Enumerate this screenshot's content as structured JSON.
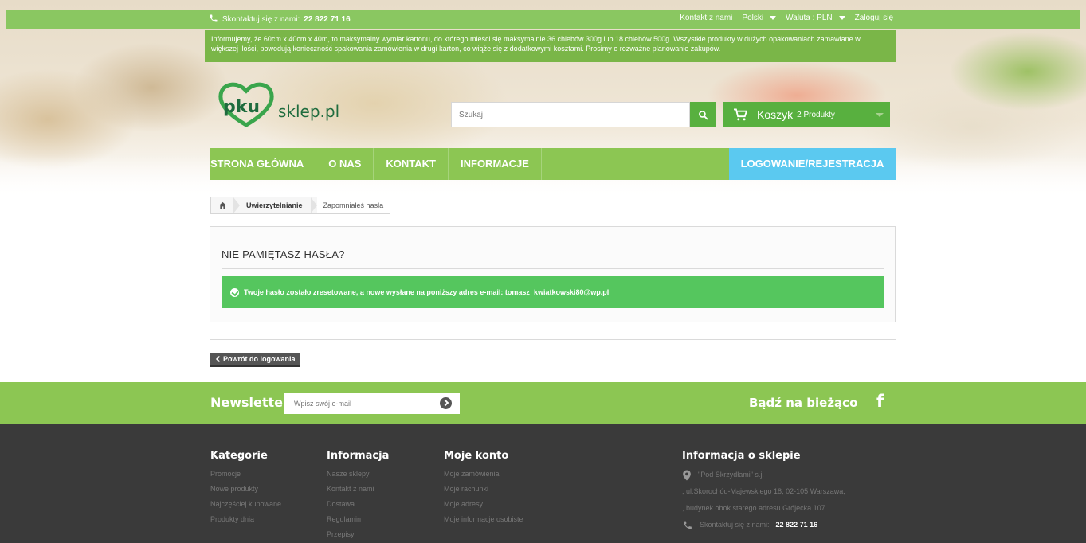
{
  "topbar": {
    "phone_label": "Skontaktuj się z nami:",
    "phone_number": "22 822 71 16",
    "contact": "Kontakt z nami",
    "language": "Polski",
    "currency": "Waluta : PLN",
    "login": "Zaloguj się"
  },
  "notice": "Informujemy, że 60cm x 40cm x 40m, to maksymalny wymiar kartonu, do którego mieści się maksymalnie 36 chlebów 300g lub 18 chlebów 500g. Wszystkie produkty w dużych opakowaniach zamawiane w większej ilości, powodują konieczność spakowania zamówienia w drugi karton, co wiąże się z dodatkowymi kosztami. Prosimy o rozważne planowanie zakupów.",
  "logo": {
    "mark": "pku",
    "text": "sklep.pl"
  },
  "search": {
    "placeholder": "Szukaj"
  },
  "cart": {
    "label": "Koszyk",
    "count": "2 Produkty"
  },
  "nav": {
    "items": [
      "STRONA GŁÓWNA",
      "O NAS",
      "KONTAKT",
      "INFORMACJE"
    ],
    "login": "LOGOWANIE/REJESTRACJA"
  },
  "breadcrumb": {
    "items": [
      "Uwierzytelnianie"
    ],
    "current": "Zapomniałeś hasła"
  },
  "main": {
    "title": "NIE PAMIĘTASZ HASŁA?",
    "alert": "Twoje hasło zostało zresetowane, a nowe wysłane na poniższy adres e-mail: tomasz_kwiatkowski80@wp.pl",
    "back": "Powrót do logowania"
  },
  "newsletter": {
    "title": "Newsletter",
    "placeholder": "Wpisz swój e-mail",
    "stay": "Bądź na bieżąco",
    "social": "f"
  },
  "footer": {
    "categories": {
      "title": "Kategorie",
      "links": [
        "Promocje",
        "Nowe produkty",
        "Najczęściej kupowane",
        "Produkty dnia"
      ]
    },
    "info": {
      "title": "Informacja",
      "links": [
        "Nasze sklepy",
        "Kontakt z nami",
        "Dostawa",
        "Regulamin",
        "Przepisy"
      ]
    },
    "account": {
      "title": "Moje konto",
      "links": [
        "Moje zamówienia",
        "Moje rachunki",
        "Moje adresy",
        "Moje informacje osobiste"
      ]
    },
    "store": {
      "title": "Informacja o sklepie",
      "name": "\"Pod Skrzydłami\" s.j.",
      "address1": ", ul.Skorochód-Majewskiego 18, 02-105 Warszawa,",
      "address2": ", budynek obok starego adresu Grójecka 107",
      "phone_label": "Skontaktuj się z nami:",
      "phone_number": "22 822 71 16"
    }
  },
  "colors": {
    "green": "#8cc653",
    "dark_green": "#58b03f",
    "blue": "#5bc9f0",
    "footer": "#3a3a3a",
    "alert": "#55c65e"
  }
}
